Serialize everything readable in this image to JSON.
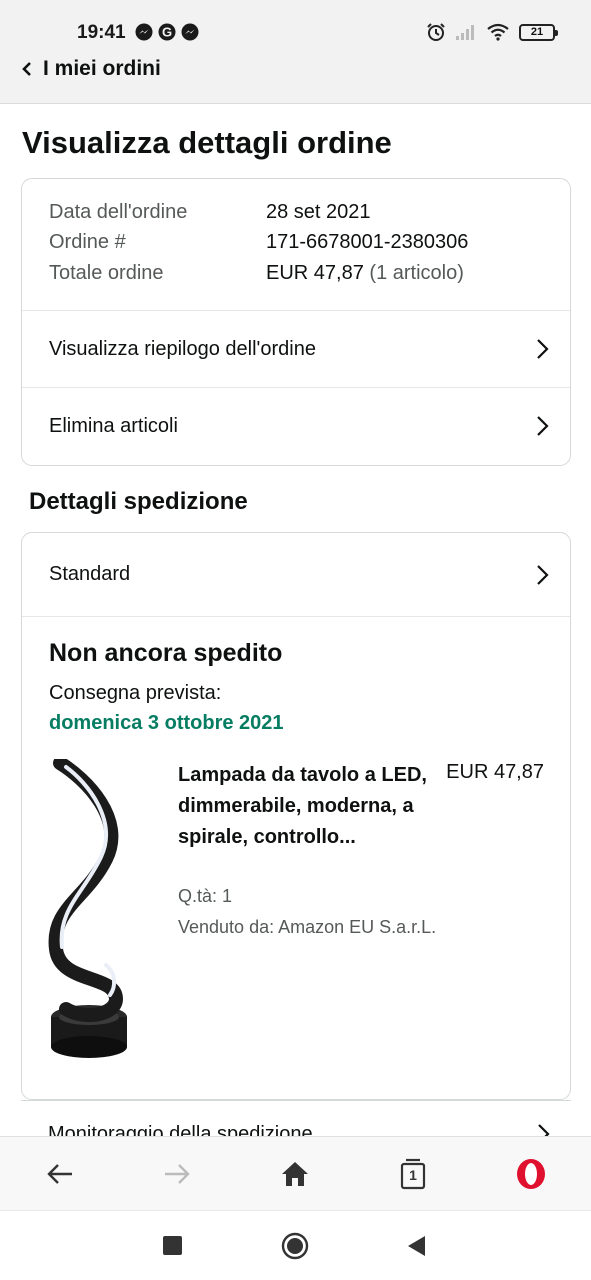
{
  "status_bar": {
    "time": "19:41",
    "left_icons": [
      "messenger-icon",
      "google-icon",
      "messenger-icon"
    ],
    "right_icons": [
      "alarm-icon",
      "signal-icon",
      "wifi-icon",
      "battery-icon"
    ],
    "battery_level": "21"
  },
  "header": {
    "back_label": "I miei ordini"
  },
  "page": {
    "title": "Visualizza dettagli ordine"
  },
  "order_info": {
    "date_label": "Data dell'ordine",
    "date_value": "28 set 2021",
    "number_label": "Ordine #",
    "number_value": "171-6678001-2380306",
    "total_label": "Totale ordine",
    "total_value": "EUR 47,87",
    "total_items": "(1 articolo)"
  },
  "order_links": [
    {
      "label": "Visualizza riepilogo dell'ordine"
    },
    {
      "label": "Elimina articoli"
    }
  ],
  "shipping": {
    "section_title": "Dettagli spedizione",
    "method": "Standard",
    "status": "Non ancora spedito",
    "delivery_label": "Consegna prevista:",
    "delivery_date": "domenica 3 ottobre 2021",
    "delivery_color": "#067d62"
  },
  "product": {
    "title": "Lampada da tavolo a LED, dimmerabile, moderna, a spirale, controllo...",
    "price": "EUR 47,87",
    "quantity": "Q.tà: 1",
    "seller": "Venduto da: Amazon EU S.a.r.L.",
    "image": "spiral-led-lamp-image"
  },
  "tracking": {
    "label": "Monitoraggio della spedizione"
  },
  "browser_nav": {
    "icons": [
      "back-arrow-icon",
      "forward-arrow-icon",
      "home-icon",
      "tabs-icon",
      "opera-icon"
    ],
    "tab_count": "1",
    "opera_color": "#e0102f"
  },
  "android_nav": {
    "icons": [
      "recents-square-icon",
      "home-circle-icon",
      "back-triangle-icon"
    ]
  }
}
